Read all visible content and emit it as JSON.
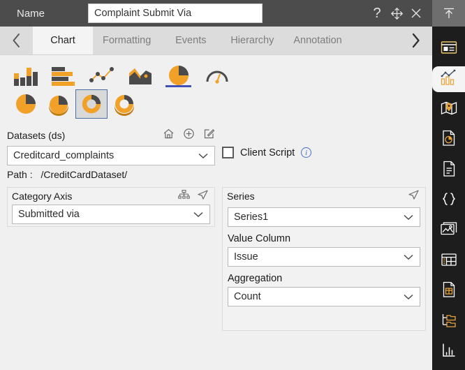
{
  "titlebar": {
    "name_label": "Name",
    "name_value": "Complaint Submit Via",
    "name_placeholder": "Name",
    "help_icon": "question-mark-icon",
    "move_icon": "move-cross-icon",
    "close_icon": "close-x-icon",
    "pin_icon": "pin-up-arrow-icon"
  },
  "tabs": {
    "prev_label": "‹",
    "next_label": "›",
    "items": [
      {
        "label": "Chart",
        "active": true
      },
      {
        "label": "Formatting",
        "active": false
      },
      {
        "label": "Events",
        "active": false
      },
      {
        "label": "Hierarchy",
        "active": false
      },
      {
        "label": "Annotation",
        "active": false
      }
    ]
  },
  "chart_types": {
    "row1": [
      {
        "name": "column-chart",
        "selected": false
      },
      {
        "name": "bar-chart",
        "selected": false
      },
      {
        "name": "line-chart",
        "selected": false
      },
      {
        "name": "area-chart",
        "selected": false
      },
      {
        "name": "pie-chart",
        "selected": true
      },
      {
        "name": "gauge-chart",
        "selected": false
      }
    ],
    "row2": [
      {
        "name": "pie-flat",
        "selected": false
      },
      {
        "name": "pie-3d",
        "selected": false
      },
      {
        "name": "donut-flat",
        "selected": true
      },
      {
        "name": "donut-3d",
        "selected": false
      }
    ]
  },
  "datasets": {
    "title": "Datasets (ds)",
    "home_icon": "home-icon",
    "add_icon": "plus-circle-icon",
    "edit_icon": "edit-pencil-icon",
    "value": "Creditcard_complaints",
    "path_label": "Path :",
    "path_value": "/CreditCardDataset/"
  },
  "client_script": {
    "label": "Client Script",
    "checked": false,
    "info_icon": "info-circle-icon",
    "info_glyph": "i"
  },
  "category_axis": {
    "title": "Category Axis",
    "hierarchy_icon": "hierarchy-icon",
    "send-icon": "send-arrow-icon",
    "value": "Submitted via"
  },
  "series": {
    "title": "Series",
    "send_icon": "send-arrow-icon",
    "series_value": "Series1",
    "value_column_label": "Value Column",
    "value_column_value": "Issue",
    "aggregation_label": "Aggregation",
    "aggregation_value": "Count"
  },
  "sidebar": {
    "items": [
      {
        "name": "card-widget-icon",
        "active": false
      },
      {
        "name": "chart-widget-icon",
        "active": true
      },
      {
        "name": "map-widget-icon",
        "active": false
      },
      {
        "name": "report-pie-icon",
        "active": false
      },
      {
        "name": "document-icon",
        "active": false
      },
      {
        "name": "code-braces-icon",
        "active": false
      },
      {
        "name": "image-icon",
        "active": false
      },
      {
        "name": "table-widget-icon",
        "active": false
      },
      {
        "name": "spreadsheet-icon",
        "active": false
      },
      {
        "name": "folder-tree-icon",
        "active": false
      },
      {
        "name": "bar-stats-icon",
        "active": false
      }
    ]
  },
  "colors": {
    "accent_orange": "#f2a128",
    "dark_gray": "#4c4c4c",
    "sidebar_bg": "#1d1d1d",
    "selected_underline": "#3f51b5",
    "panel_bg": "#f2f2f2"
  }
}
